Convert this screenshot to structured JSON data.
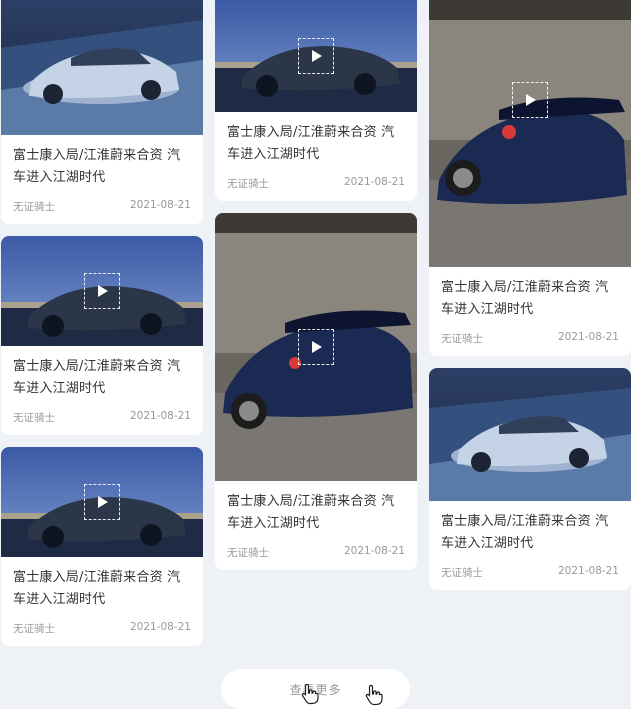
{
  "feed": {
    "columns": [
      [
        {
          "title": "富士康入局/江淮蔚来合资 汽车进入江湖时代",
          "author": "无证骑士",
          "date": "2021-08-21",
          "scene": "sedan-blue",
          "video": false
        },
        {
          "title": "富士康入局/江淮蔚来合资 汽车进入江湖时代",
          "author": "无证骑士",
          "date": "2021-08-21",
          "scene": "coupe-night",
          "video": true
        },
        {
          "title": "富士康入局/江淮蔚来合资 汽车进入江湖时代",
          "author": "无证骑士",
          "date": "2021-08-21",
          "scene": "coupe-night",
          "video": true
        }
      ],
      [
        {
          "title": "富士康入局/江淮蔚来合资 汽车进入江湖时代",
          "author": "无证骑士",
          "date": "2021-08-21",
          "scene": "coupe-night",
          "video": true
        },
        {
          "title": "富士康入局/江淮蔚来合资 汽车进入江湖时代",
          "author": "无证骑士",
          "date": "2021-08-21",
          "scene": "gtr-wall",
          "video": true
        }
      ],
      [
        {
          "title": "富士康入局/江淮蔚来合资 汽车进入江湖时代",
          "author": "无证骑士",
          "date": "2021-08-21",
          "scene": "gtr-wall",
          "video": true
        },
        {
          "title": "富士康入局/江淮蔚来合资 汽车进入江湖时代",
          "author": "无证骑士",
          "date": "2021-08-21",
          "scene": "sedan-blue",
          "video": false
        }
      ]
    ]
  },
  "load_more": {
    "label": "查看更多"
  },
  "icons": {
    "play": "play-icon",
    "cursor": "hand-pointer-icon"
  },
  "colors": {
    "background": "#eef1f6",
    "card": "#ffffff",
    "title": "#333333",
    "meta": "#999999"
  }
}
